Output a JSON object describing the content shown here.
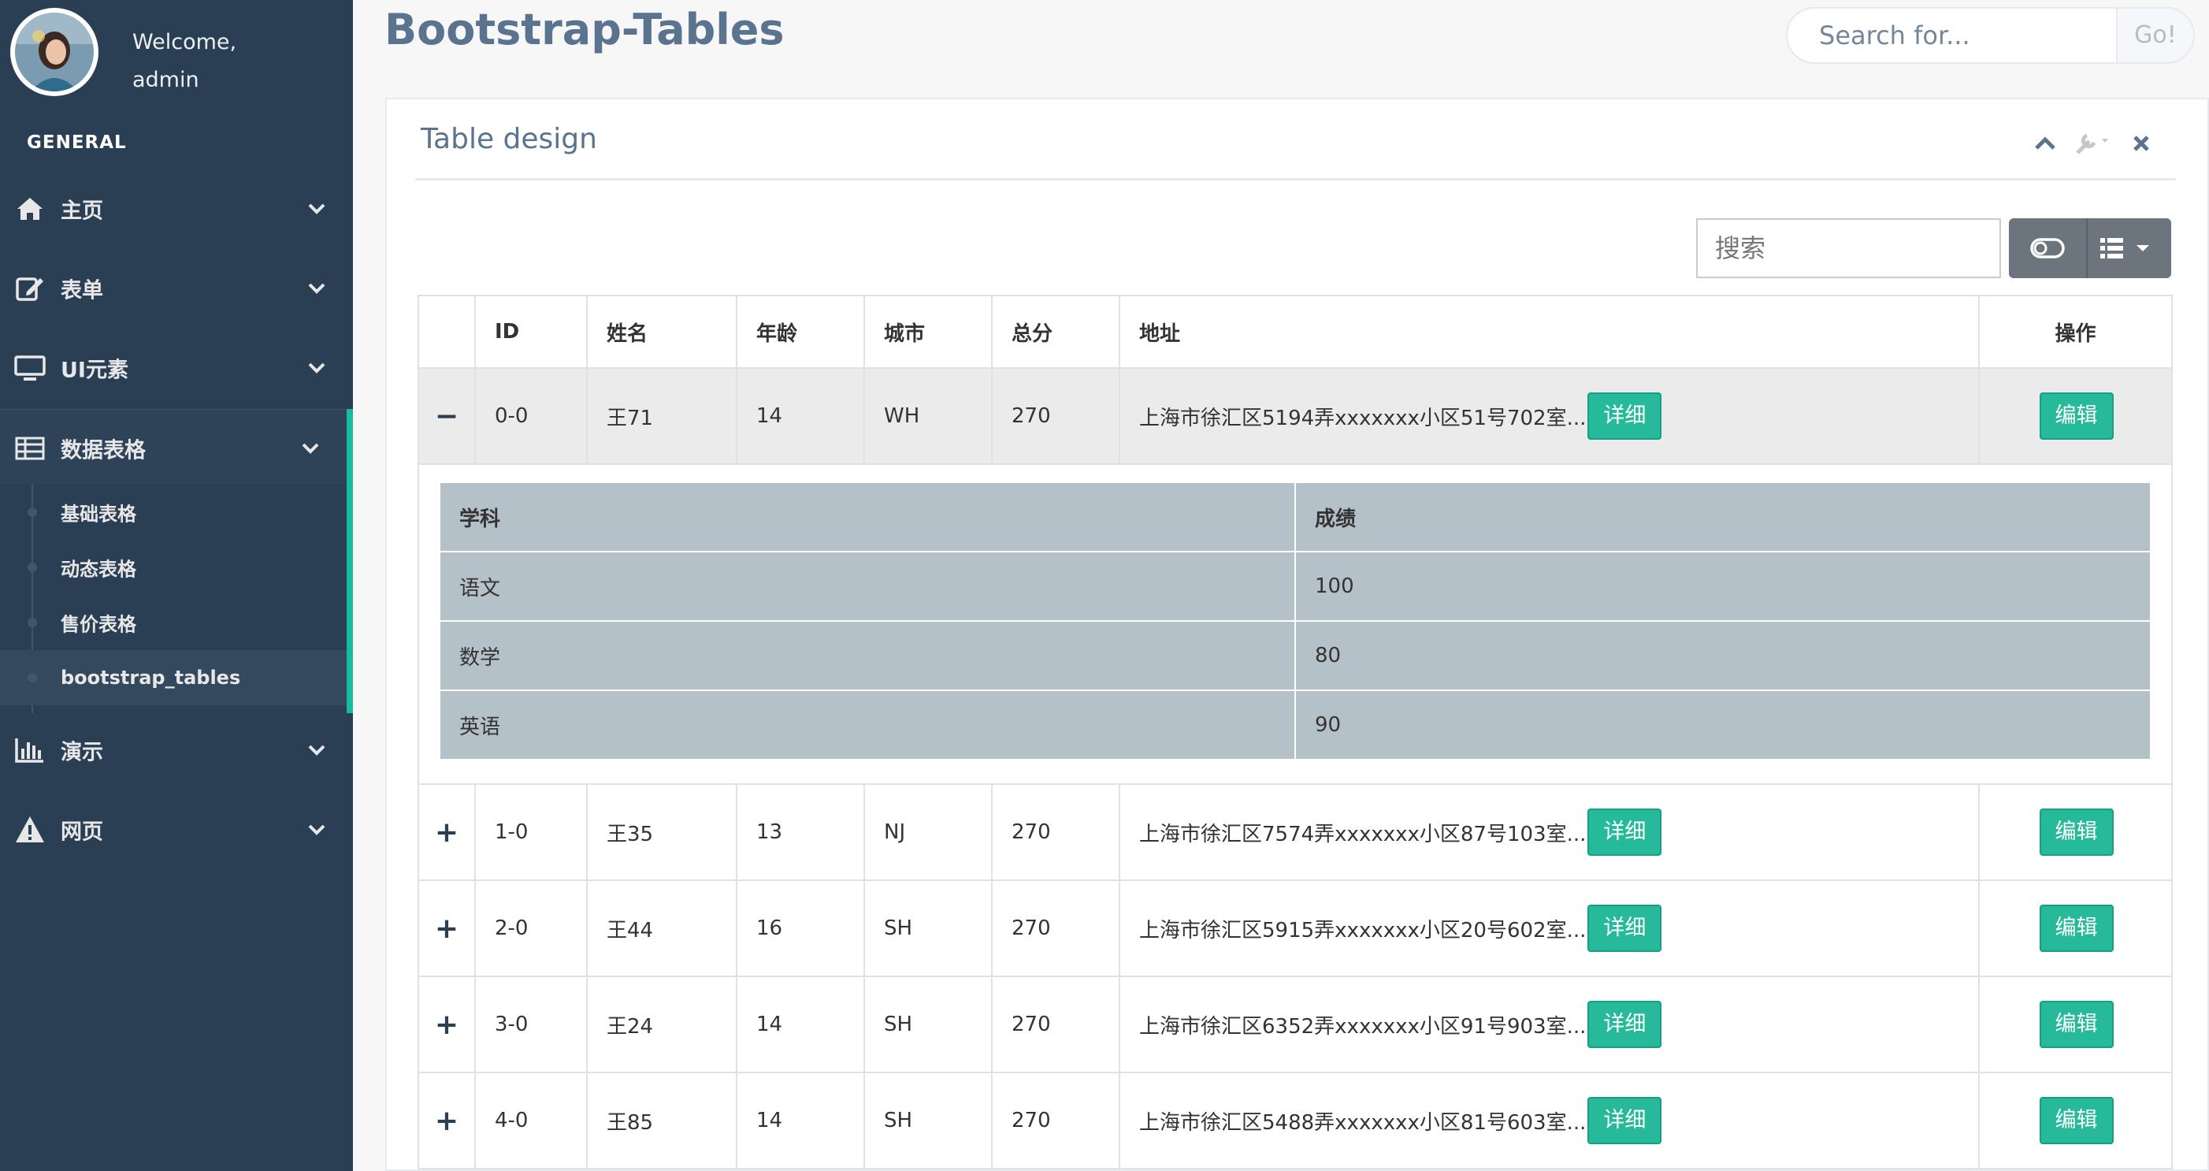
{
  "user": {
    "welcome": "Welcome,",
    "name": "admin"
  },
  "sidebar": {
    "section": "GENERAL",
    "items": [
      {
        "label": "主页",
        "icon": "home-icon"
      },
      {
        "label": "表单",
        "icon": "edit-icon"
      },
      {
        "label": "UI元素",
        "icon": "desktop-icon"
      },
      {
        "label": "数据表格",
        "icon": "table-icon"
      },
      {
        "label": "演示",
        "icon": "bar-chart-icon"
      },
      {
        "label": "网页",
        "icon": "warning-icon"
      }
    ],
    "submenu": [
      "基础表格",
      "动态表格",
      "售价表格",
      "bootstrap_tables"
    ]
  },
  "header": {
    "title": "Bootstrap-Tables",
    "search_placeholder": "Search for...",
    "go": "Go!"
  },
  "panel": {
    "title": "Table design"
  },
  "table": {
    "search_placeholder": "搜索",
    "columns": [
      "ID",
      "姓名",
      "年龄",
      "城市",
      "总分",
      "地址",
      "操作"
    ],
    "detail_label": "详细",
    "edit_label": "编辑",
    "rows": [
      {
        "toggle": "−",
        "id": "0-0",
        "name": "王71",
        "age": "14",
        "city": "WH",
        "total": "270",
        "addr": "上海市徐汇区5194弄xxxxxxx小区51号702室..."
      },
      {
        "toggle": "+",
        "id": "1-0",
        "name": "王35",
        "age": "13",
        "city": "NJ",
        "total": "270",
        "addr": "上海市徐汇区7574弄xxxxxxx小区87号103室..."
      },
      {
        "toggle": "+",
        "id": "2-0",
        "name": "王44",
        "age": "16",
        "city": "SH",
        "total": "270",
        "addr": "上海市徐汇区5915弄xxxxxxx小区20号602室..."
      },
      {
        "toggle": "+",
        "id": "3-0",
        "name": "王24",
        "age": "14",
        "city": "SH",
        "total": "270",
        "addr": "上海市徐汇区6352弄xxxxxxx小区91号903室..."
      },
      {
        "toggle": "+",
        "id": "4-0",
        "name": "王85",
        "age": "14",
        "city": "SH",
        "total": "270",
        "addr": "上海市徐汇区5488弄xxxxxxx小区81号603室..."
      }
    ]
  },
  "subtable": {
    "headers": [
      "学科",
      "成绩"
    ],
    "rows": [
      {
        "subject": "语文",
        "score": "100"
      },
      {
        "subject": "数学",
        "score": "80"
      },
      {
        "subject": "英语",
        "score": "90"
      }
    ]
  }
}
